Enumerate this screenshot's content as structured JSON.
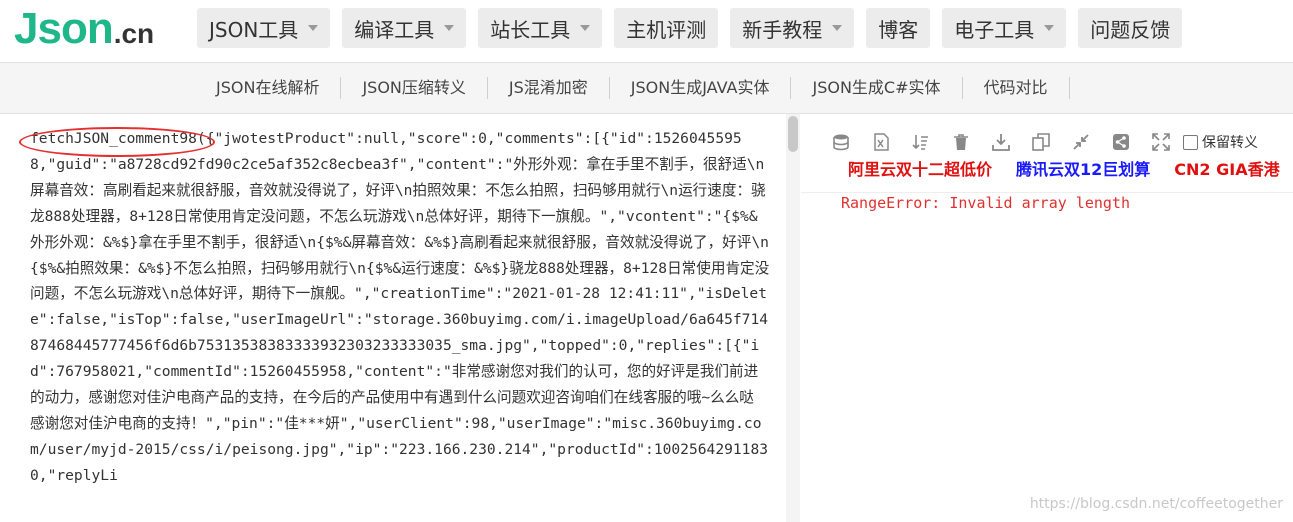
{
  "logo": {
    "main": "Json",
    "suffix": ".cn"
  },
  "nav": [
    {
      "label": "JSON工具",
      "dropdown": true
    },
    {
      "label": "编译工具",
      "dropdown": true
    },
    {
      "label": "站长工具",
      "dropdown": true
    },
    {
      "label": "主机评测",
      "dropdown": false
    },
    {
      "label": "新手教程",
      "dropdown": true
    },
    {
      "label": "博客",
      "dropdown": false
    },
    {
      "label": "电子工具",
      "dropdown": true
    },
    {
      "label": "问题反馈",
      "dropdown": false
    }
  ],
  "subnav": [
    "JSON在线解析",
    "JSON压缩转义",
    "JS混淆加密",
    "JSON生成JAVA实体",
    "JSON生成C#实体",
    "代码对比"
  ],
  "editor": {
    "content": "fetchJSON_comment98({\"jwotestProduct\":null,\"score\":0,\"comments\":[{\"id\":15260455958,\"guid\":\"a8728cd92fd90c2ce5af352c8ecbea3f\",\"content\":\"外形外观：拿在手里不割手，很舒适\\n屏幕音效：高刷看起来就很舒服，音效就没得说了，好评\\n拍照效果：不怎么拍照，扫码够用就行\\n运行速度：骁龙888处理器，8+128日常使用肯定没问题，不怎么玩游戏\\n总体好评，期待下一旗舰。\",\"vcontent\":\"{$%&外形外观：&%$}拿在手里不割手，很舒适\\n{$%&屏幕音效：&%$}高刷看起来就很舒服，音效就没得说了，好评\\n{$%&拍照效果：&%$}不怎么拍照，扫码够用就行\\n{$%&运行速度：&%$}骁龙888处理器，8+128日常使用肯定没问题，不怎么玩游戏\\n总体好评，期待下一旗舰。\",\"creationTime\":\"2021-01-28 12:41:11\",\"isDelete\":false,\"isTop\":false,\"userImageUrl\":\"storage.360buyimg.com/i.imageUpload/6a645f71487468445777456f6d6b75313538383333932303233333035_sma.jpg\",\"topped\":0,\"replies\":[{\"id\":767958021,\"commentId\":15260455958,\"content\":\"非常感谢您对我们的认可，您的好评是我们前进的动力，感谢您对佳沪电商产品的支持，在今后的产品使用中有遇到什么问题欢迎咨询咱们在线客服的哦~么么哒 感谢您对佳沪电商的支持！\",\"pin\":\"佳***妍\",\"userClient\":98,\"userImage\":\"misc.360buyimg.com/user/myjd-2015/css/i/peisong.jpg\",\"ip\":\"223.166.230.214\",\"productId\":10025642911830,\"replyLi"
  },
  "toolbar": {
    "icons": [
      "database-icon",
      "excel-icon",
      "sort-icon",
      "delete-icon",
      "download-icon",
      "copy-icon",
      "compress-icon",
      "share-icon",
      "expand-icon"
    ],
    "keep_escape_label": "保留转义"
  },
  "ads": [
    {
      "text": "阿里云双十二超低价",
      "color": "#e01010"
    },
    {
      "text": "腾讯云双12巨划算",
      "color": "#1a1aff"
    },
    {
      "text": "CN2 GIA香港",
      "color": "#e01010"
    }
  ],
  "result": {
    "error": "RangeError: Invalid array length"
  },
  "watermark": "https://blog.csdn.net/coffeetogether"
}
